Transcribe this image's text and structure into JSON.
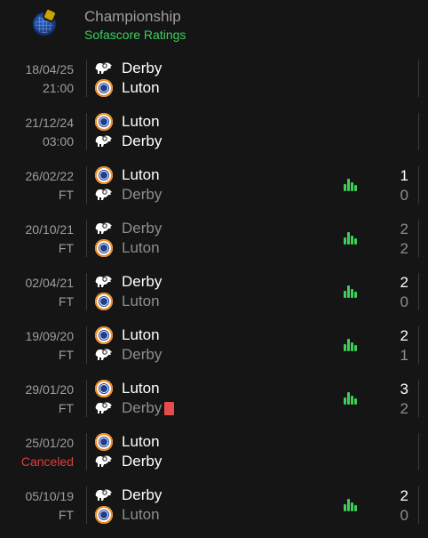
{
  "header": {
    "league": "Championship",
    "subtitle": "Sofascore Ratings"
  },
  "colors": {
    "accent_green": "#3ccf5a",
    "canceled_red": "#e13b3b",
    "red_card": "#e64c4c"
  },
  "matches": [
    {
      "date": "18/04/25",
      "status": "21:00",
      "status_kind": "time",
      "home": {
        "name": "Derby",
        "crest": "derby-ram",
        "winner": null
      },
      "away": {
        "name": "Luton",
        "crest": "luton-crest",
        "winner": null
      },
      "score": null,
      "has_stats": false
    },
    {
      "date": "21/12/24",
      "status": "03:00",
      "status_kind": "time",
      "home": {
        "name": "Luton",
        "crest": "luton-crest",
        "winner": null
      },
      "away": {
        "name": "Derby",
        "crest": "derby-ram",
        "winner": null
      },
      "score": null,
      "has_stats": false
    },
    {
      "date": "26/02/22",
      "status": "FT",
      "status_kind": "finished",
      "home": {
        "name": "Luton",
        "crest": "luton-crest",
        "winner": true
      },
      "away": {
        "name": "Derby",
        "crest": "derby-ram",
        "winner": false
      },
      "score": {
        "home": "1",
        "away": "0"
      },
      "has_stats": true
    },
    {
      "date": "20/10/21",
      "status": "FT",
      "status_kind": "finished",
      "home": {
        "name": "Derby",
        "crest": "derby-ram",
        "winner": false
      },
      "away": {
        "name": "Luton",
        "crest": "luton-crest",
        "winner": false
      },
      "score": {
        "home": "2",
        "away": "2"
      },
      "has_stats": true
    },
    {
      "date": "02/04/21",
      "status": "FT",
      "status_kind": "finished",
      "home": {
        "name": "Derby",
        "crest": "derby-ram",
        "winner": true
      },
      "away": {
        "name": "Luton",
        "crest": "luton-crest",
        "winner": false
      },
      "score": {
        "home": "2",
        "away": "0"
      },
      "has_stats": true
    },
    {
      "date": "19/09/20",
      "status": "FT",
      "status_kind": "finished",
      "home": {
        "name": "Luton",
        "crest": "luton-crest",
        "winner": true
      },
      "away": {
        "name": "Derby",
        "crest": "derby-ram",
        "winner": false
      },
      "score": {
        "home": "2",
        "away": "1"
      },
      "has_stats": true
    },
    {
      "date": "29/01/20",
      "status": "FT",
      "status_kind": "finished",
      "home": {
        "name": "Luton",
        "crest": "luton-crest",
        "winner": true
      },
      "away": {
        "name": "Derby",
        "crest": "derby-ram",
        "winner": false,
        "red_card": true
      },
      "score": {
        "home": "3",
        "away": "2"
      },
      "has_stats": true
    },
    {
      "date": "25/01/20",
      "status": "Canceled",
      "status_kind": "canceled",
      "home": {
        "name": "Luton",
        "crest": "luton-crest",
        "winner": null
      },
      "away": {
        "name": "Derby",
        "crest": "derby-ram",
        "winner": null
      },
      "score": null,
      "has_stats": false
    },
    {
      "date": "05/10/19",
      "status": "FT",
      "status_kind": "finished",
      "home": {
        "name": "Derby",
        "crest": "derby-ram",
        "winner": true
      },
      "away": {
        "name": "Luton",
        "crest": "luton-crest",
        "winner": false
      },
      "score": {
        "home": "2",
        "away": "0"
      },
      "has_stats": true
    }
  ]
}
